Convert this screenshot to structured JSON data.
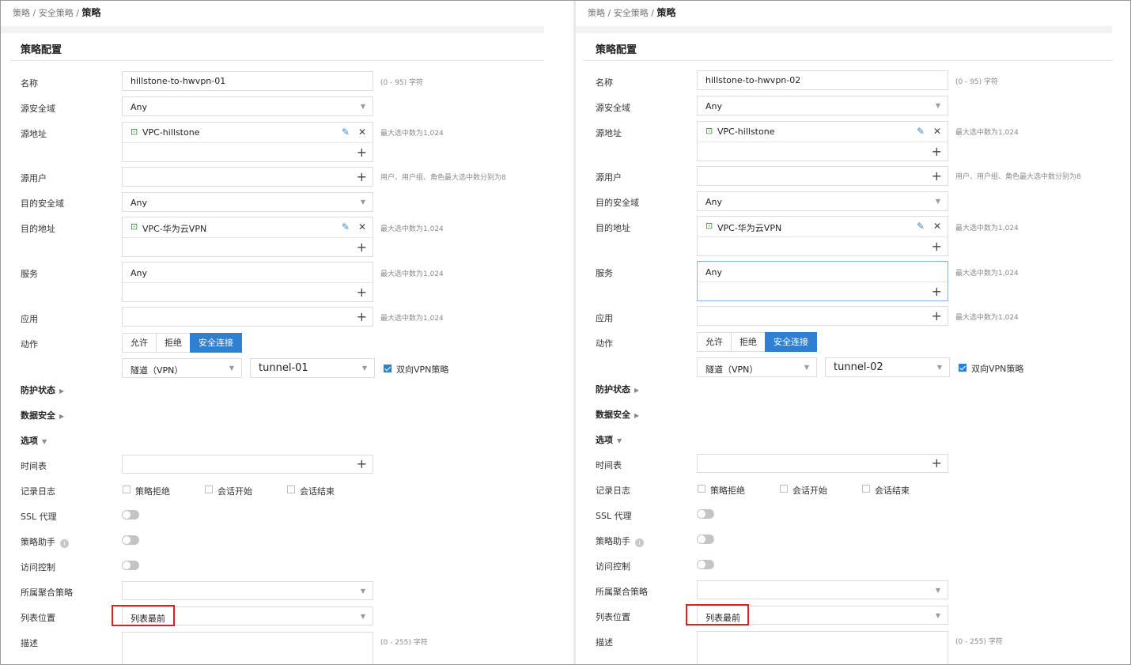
{
  "breadcrumb": {
    "part1": "策略",
    "part2": "安全策略",
    "sep": "/",
    "current": "策略"
  },
  "card_title": "策略配置",
  "labels": {
    "name": "名称",
    "src_zone": "源安全域",
    "src_addr": "源地址",
    "src_user": "源用户",
    "dst_zone": "目的安全域",
    "dst_addr": "目的地址",
    "service": "服务",
    "app": "应用",
    "action": "动作",
    "protect": "防护状态",
    "data_sec": "数据安全",
    "options": "选项",
    "schedule": "时间表",
    "log": "记录日志",
    "ssl": "SSL 代理",
    "assistant": "策略助手",
    "access": "访问控制",
    "aggregate": "所属聚合策略",
    "position": "列表位置",
    "desc": "描述"
  },
  "hints": {
    "name": "(0 - 95) 字符",
    "max": "最大选中数为1,024",
    "user": "用户、用户组、角色最大选中数分别为8",
    "desc": "(0 - 255) 字符"
  },
  "values": {
    "any": "Any",
    "src_addr": "VPC-hillstone",
    "dst_addr": "VPC-华为云VPN",
    "tunnel_type": "隧道（VPN）",
    "bidir": "双向VPN策略",
    "position": "列表最前"
  },
  "action_buttons": [
    "允许",
    "拒绝",
    "安全连接"
  ],
  "log_options": [
    "策略拒绝",
    "会话开始",
    "会话结束"
  ],
  "panels": [
    {
      "policy_name": "hillstone-to-hwvpn-01",
      "tunnel": "tunnel-01"
    },
    {
      "policy_name": "hillstone-to-hwvpn-02",
      "tunnel": "tunnel-02"
    }
  ],
  "icons": {
    "dropdown": "caret-down-icon",
    "add": "plus-icon",
    "edit": "pencil-icon",
    "remove": "close-icon",
    "address": "address-book-icon",
    "info": "info-icon",
    "expand": "caret-right-icon"
  },
  "colors": {
    "accent": "#2f7fd2",
    "highlight_box": "#e02020",
    "icon_green": "#3b8f3b"
  }
}
